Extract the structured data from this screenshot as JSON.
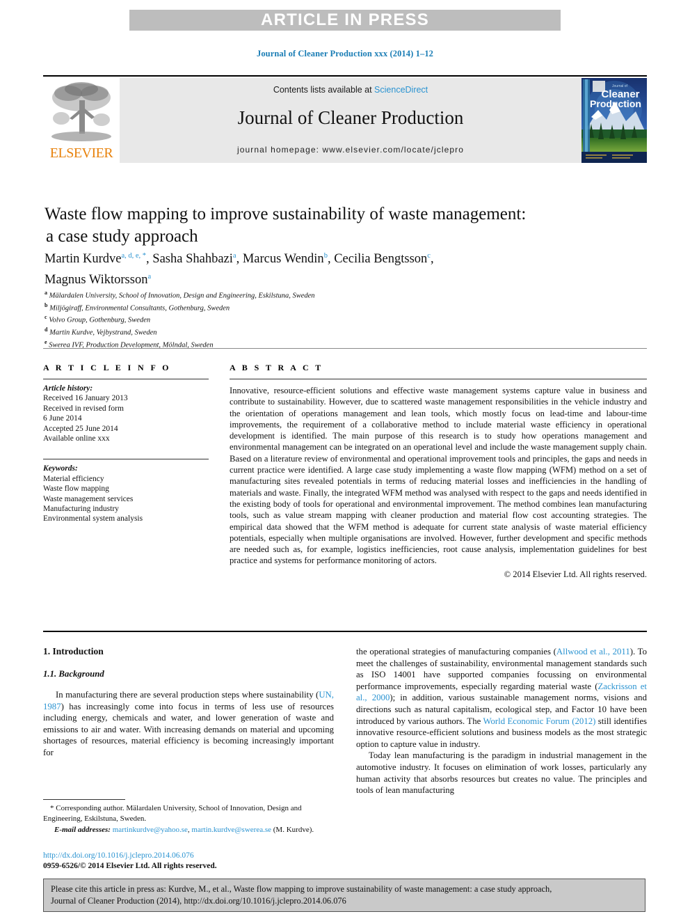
{
  "banner": {
    "text": "ARTICLE IN PRESS"
  },
  "journal_ref": "Journal of Cleaner Production xxx (2014) 1–12",
  "masthead": {
    "contents_prefix": "Contents lists available at ",
    "sciencedirect": "ScienceDirect",
    "journal_title": "Journal of Cleaner Production",
    "homepage": "journal homepage: www.elsevier.com/locate/jclepro",
    "publisher_logo_text": "ELSEVIER",
    "cover": {
      "line1": "Journal of",
      "line2": "Cleaner",
      "line3": "Production"
    }
  },
  "article": {
    "title_line1": "Waste flow mapping to improve sustainability of waste management:",
    "title_line2": "a case study approach",
    "authors": [
      {
        "name": "Martin Kurdve",
        "marks": "a, d, e, *",
        "sep": ", "
      },
      {
        "name": "Sasha Shahbazi",
        "marks": "a",
        "sep": ", "
      },
      {
        "name": "Marcus Wendin",
        "marks": "b",
        "sep": ", "
      },
      {
        "name": "Cecilia Bengtsson",
        "marks": "c",
        "sep": ","
      },
      {
        "name": "Magnus Wiktorsson",
        "marks": "a",
        "sep": ""
      }
    ],
    "affiliations": [
      {
        "mark": "a",
        "text": "Mälardalen University, School of Innovation, Design and Engineering, Eskilstuna, Sweden"
      },
      {
        "mark": "b",
        "text": "Miljögiraff, Environmental Consultants, Gothenburg, Sweden"
      },
      {
        "mark": "c",
        "text": "Volvo Group, Gothenburg, Sweden"
      },
      {
        "mark": "d",
        "text": "Martin Kurdve, Vejbystrand, Sweden"
      },
      {
        "mark": "e",
        "text": "Swerea IVF, Production Development, Mölndal, Sweden"
      }
    ]
  },
  "article_info": {
    "heading": "A R T I C L E  I N F O",
    "history_label": "Article history:",
    "history": [
      "Received 16 January 2013",
      "Received in revised form",
      "6 June 2014",
      "Accepted 25 June 2014",
      "Available online xxx"
    ],
    "keywords_label": "Keywords:",
    "keywords": [
      "Material efficiency",
      "Waste flow mapping",
      "Waste management services",
      "Manufacturing industry",
      "Environmental system analysis"
    ]
  },
  "abstract": {
    "heading": "A B S T R A C T",
    "text": "Innovative, resource-efficient solutions and effective waste management systems capture value in business and contribute to sustainability. However, due to scattered waste management responsibilities in the vehicle industry and the orientation of operations management and lean tools, which mostly focus on lead-time and labour-time improvements, the requirement of a collaborative method to include material waste efficiency in operational development is identified. The main purpose of this research is to study how operations management and environmental management can be integrated on an operational level and include the waste management supply chain. Based on a literature review of environmental and operational improvement tools and principles, the gaps and needs in current practice were identified. A large case study implementing a waste flow mapping (WFM) method on a set of manufacturing sites revealed potentials in terms of reducing material losses and inefficiencies in the handling of materials and waste. Finally, the integrated WFM method was analysed with respect to the gaps and needs identified in the existing body of tools for operational and environmental improvement. The method combines lean manufacturing tools, such as value stream mapping with cleaner production and material flow cost accounting strategies. The empirical data showed that the WFM method is adequate for current state analysis of waste material efficiency potentials, especially when multiple organisations are involved. However, further development and specific methods are needed such as, for example, logistics inefficiencies, root cause analysis, implementation guidelines for best practice and systems for performance monitoring of actors.",
    "copyright": "© 2014 Elsevier Ltd. All rights reserved."
  },
  "body": {
    "section_heading": "1. Introduction",
    "subsection_heading": "1.1. Background",
    "left_para_1_pre": "In manufacturing there are several production steps where sustainability (",
    "left_cite_1": "UN, 1987",
    "left_para_1_post": ") has increasingly come into focus in terms of less use of resources including energy, chemicals and water, and lower generation of waste and emissions to air and water. With increasing demands on material and upcoming shortages of resources, material efficiency is becoming increasingly important for",
    "right_para_1_pre": "the operational strategies of manufacturing companies (",
    "right_cite_1": "Allwood et al., 2011",
    "right_para_1_mid": "). To meet the challenges of sustainability, environmental management standards such as ISO 14001 have supported companies focussing on environmental performance improvements, especially regarding material waste (",
    "right_cite_2": "Zackrisson et al., 2000",
    "right_para_1_mid2": "); in addition, various sustainable management norms, visions and directions such as natural capitalism, ecological step, and Factor 10 have been introduced by various authors. The ",
    "right_cite_3": "World Economic Forum (2012)",
    "right_para_1_post": " still identifies innovative resource-efficient solutions and business models as the most strategic option to capture value in industry.",
    "right_para_2": "Today lean manufacturing is the paradigm in industrial management in the automotive industry. It focuses on elimination of work losses, particularly any human activity that absorbs resources but creates no value. The principles and tools of lean manufacturing"
  },
  "footnotes": {
    "corresponding": "* Corresponding author. Mälardalen University, School of Innovation, Design and Engineering, Eskilstuna, Sweden.",
    "email_label": "E-mail addresses:",
    "email_1": "martinkurdve@yahoo.se",
    "email_sep": ", ",
    "email_2": "martin.kurdve@swerea.se",
    "email_suffix": " (M. Kurdve)."
  },
  "doi_block": {
    "doi_url": "http://dx.doi.org/10.1016/j.jclepro.2014.06.076",
    "issn_line": "0959-6526/© 2014 Elsevier Ltd. All rights reserved."
  },
  "cite_box": {
    "line1": "Please cite this article in press as: Kurdve, M., et al., Waste flow mapping to improve sustainability of waste management: a case study approach,",
    "line2": "Journal of Cleaner Production (2014), http://dx.doi.org/10.1016/j.jclepro.2014.06.076"
  },
  "colors": {
    "banner_bg": "#bdbdbd",
    "link_blue": "#2a93d1",
    "elsevier_orange": "#e8820c",
    "masthead_bg": "#e8e8e8",
    "cite_box_bg": "#c9c9c9"
  }
}
